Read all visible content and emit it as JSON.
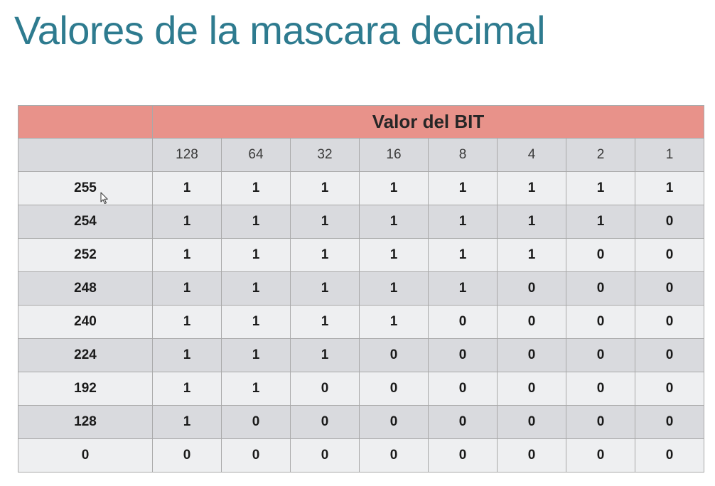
{
  "title": "Valores de la mascara decimal",
  "table": {
    "header": "Valor del BIT",
    "bit_values": [
      "128",
      "64",
      "32",
      "16",
      "8",
      "4",
      "2",
      "1"
    ],
    "rows": [
      {
        "decimal": "255",
        "bits": [
          "1",
          "1",
          "1",
          "1",
          "1",
          "1",
          "1",
          "1"
        ]
      },
      {
        "decimal": "254",
        "bits": [
          "1",
          "1",
          "1",
          "1",
          "1",
          "1",
          "1",
          "0"
        ]
      },
      {
        "decimal": "252",
        "bits": [
          "1",
          "1",
          "1",
          "1",
          "1",
          "1",
          "0",
          "0"
        ]
      },
      {
        "decimal": "248",
        "bits": [
          "1",
          "1",
          "1",
          "1",
          "1",
          "0",
          "0",
          "0"
        ]
      },
      {
        "decimal": "240",
        "bits": [
          "1",
          "1",
          "1",
          "1",
          "0",
          "0",
          "0",
          "0"
        ]
      },
      {
        "decimal": "224",
        "bits": [
          "1",
          "1",
          "1",
          "0",
          "0",
          "0",
          "0",
          "0"
        ]
      },
      {
        "decimal": "192",
        "bits": [
          "1",
          "1",
          "0",
          "0",
          "0",
          "0",
          "0",
          "0"
        ]
      },
      {
        "decimal": "128",
        "bits": [
          "1",
          "0",
          "0",
          "0",
          "0",
          "0",
          "0",
          "0"
        ]
      },
      {
        "decimal": "0",
        "bits": [
          "0",
          "0",
          "0",
          "0",
          "0",
          "0",
          "0",
          "0"
        ]
      }
    ]
  },
  "colors": {
    "title": "#2e7b8f",
    "header_fill": "#e8928a",
    "row_light": "#eeeff1",
    "row_dark": "#d9dade",
    "border": "#a9a9a9"
  },
  "icons": {
    "pointer": "mouse-pointer-icon"
  }
}
